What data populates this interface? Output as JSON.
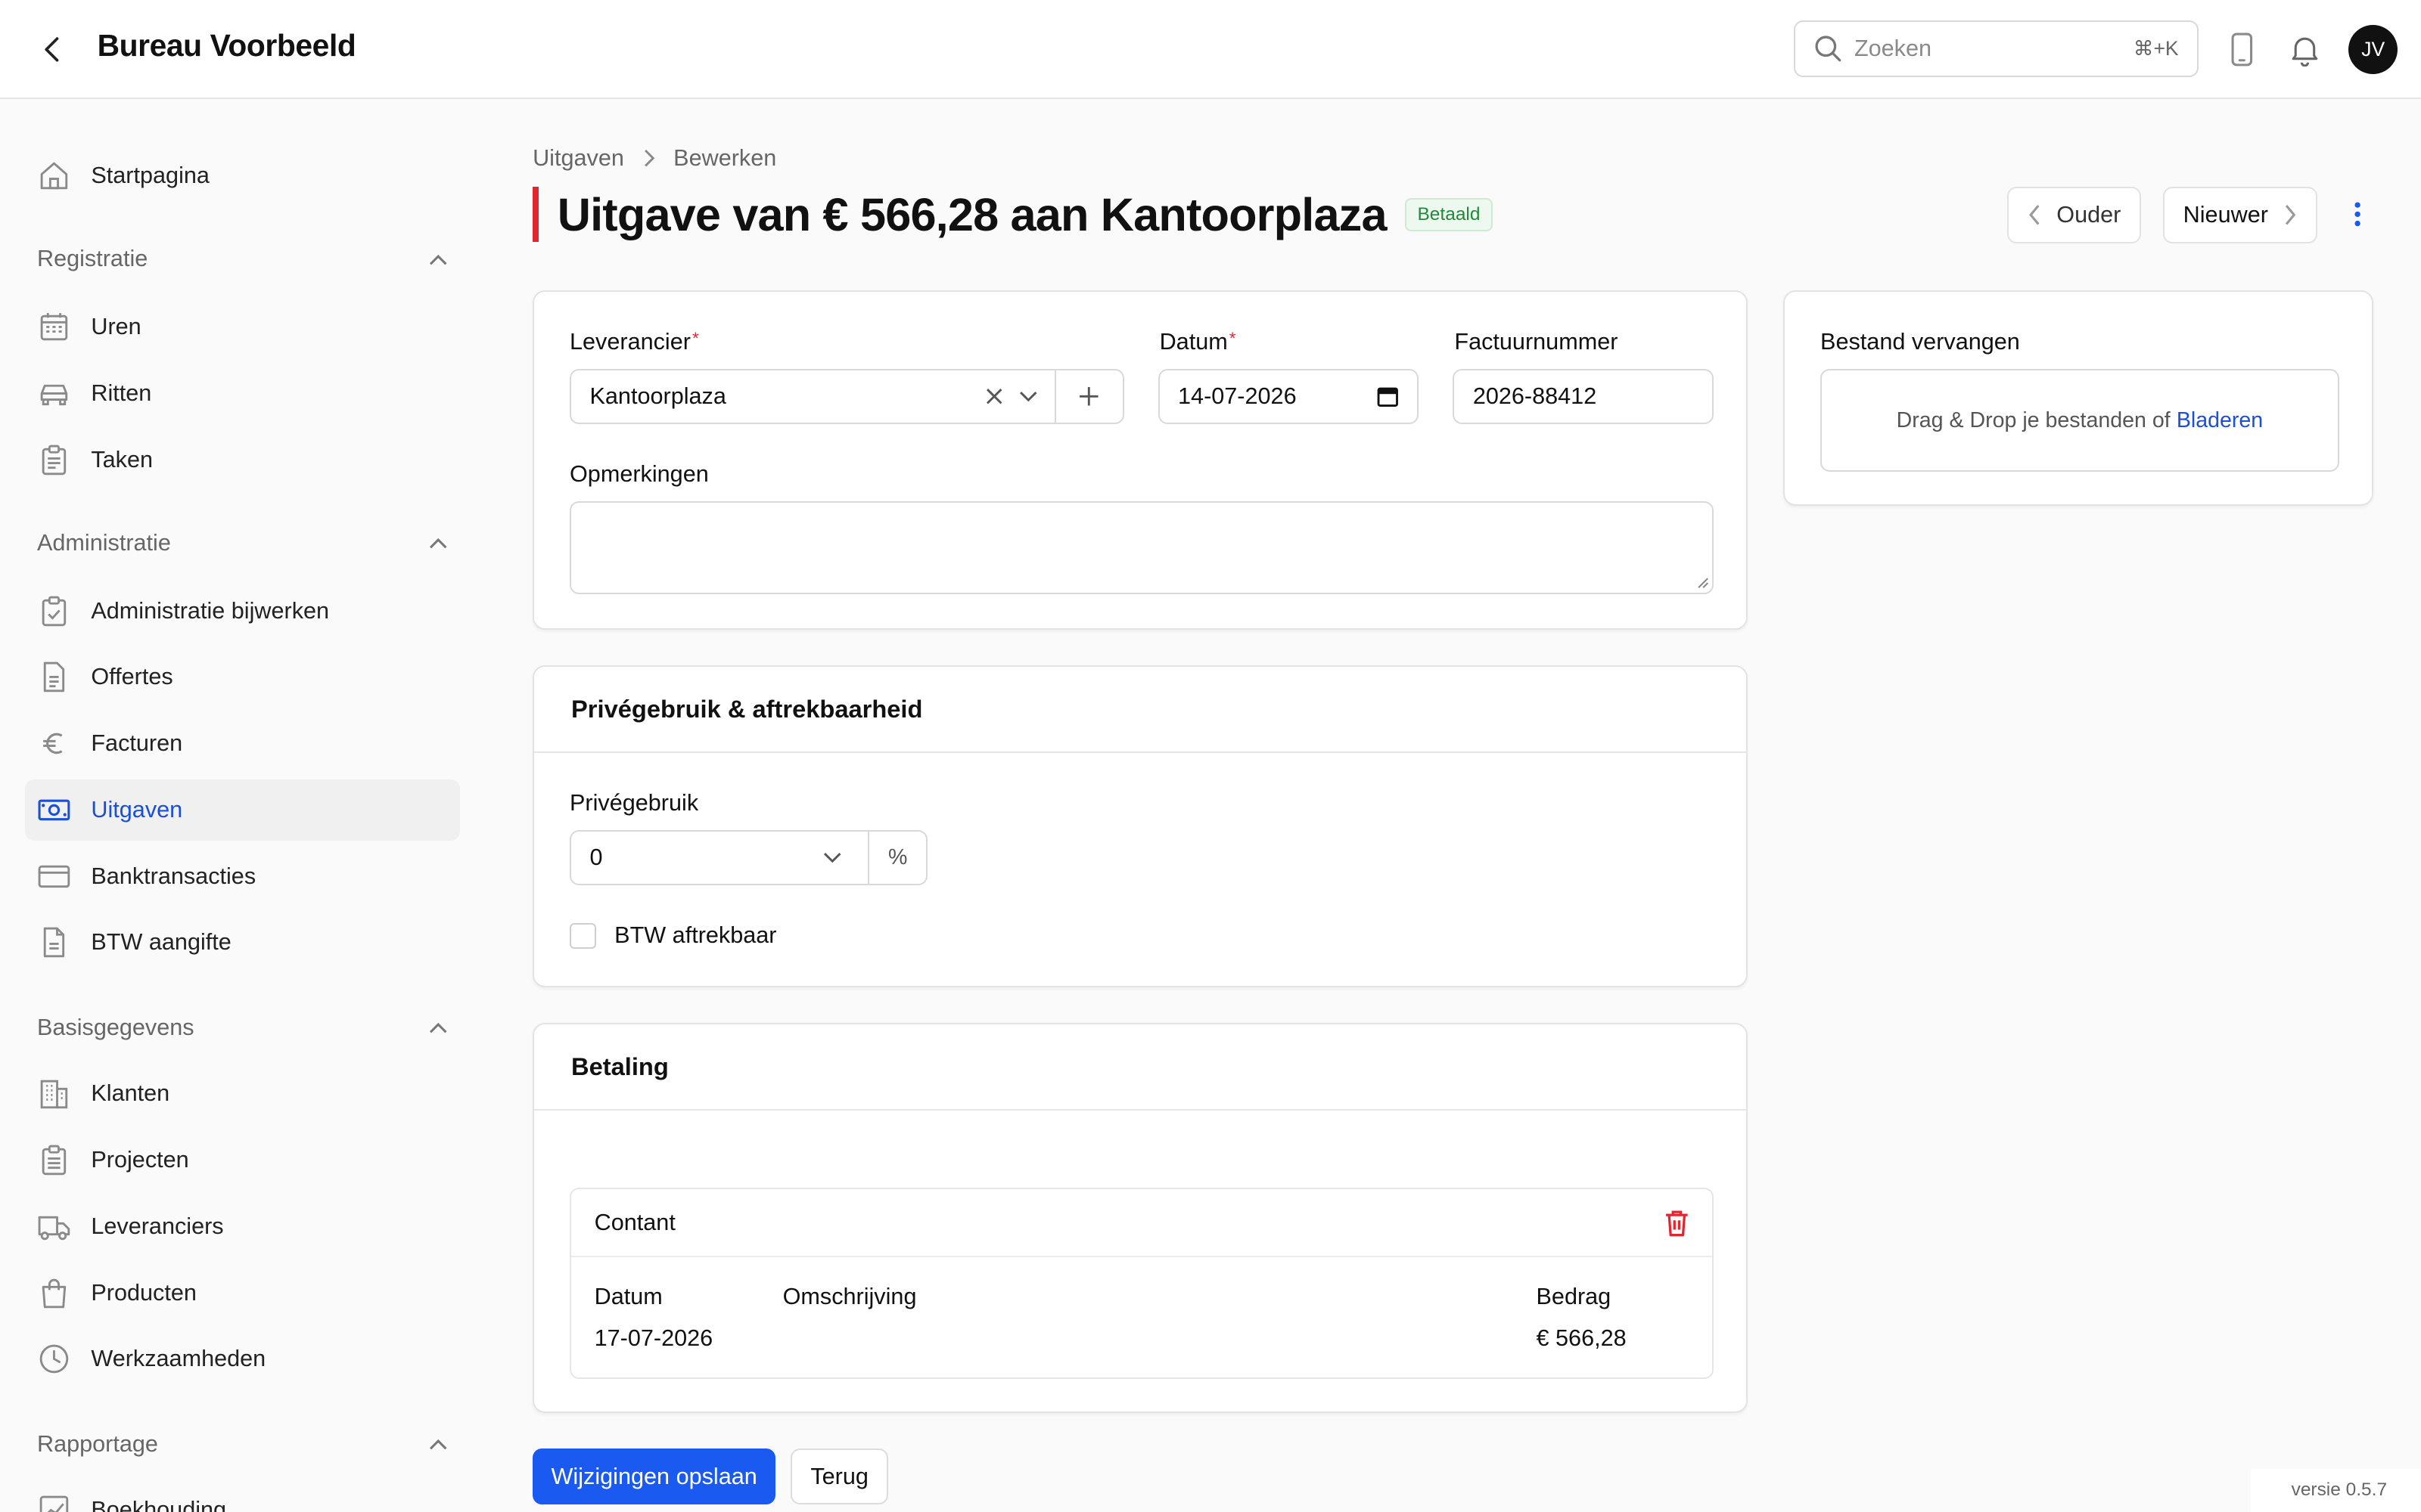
{
  "app": {
    "title": "Bureau Voorbeeld"
  },
  "topbar": {
    "search_placeholder": "Zoeken",
    "search_shortcut": "⌘+K",
    "avatar_initials": "JV"
  },
  "sidebar": {
    "home": "Startpagina",
    "sections": [
      {
        "title": "Registratie",
        "items": [
          "Uren",
          "Ritten",
          "Taken"
        ]
      },
      {
        "title": "Administratie",
        "items": [
          "Administratie bijwerken",
          "Offertes",
          "Facturen",
          "Uitgaven",
          "Banktransacties",
          "BTW aangifte"
        ]
      },
      {
        "title": "Basisgegevens",
        "items": [
          "Klanten",
          "Projecten",
          "Leveranciers",
          "Producten",
          "Werkzaamheden"
        ]
      },
      {
        "title": "Rapportage",
        "items": [
          "Boekhouding"
        ]
      }
    ],
    "active_item": "Uitgaven"
  },
  "breadcrumb": {
    "parent": "Uitgaven",
    "current": "Bewerken"
  },
  "page": {
    "title": "Uitgave van € 566,28 aan Kantoorplaza",
    "status": "Betaald",
    "prev_label": "Ouder",
    "next_label": "Nieuwer"
  },
  "form": {
    "supplier_label": "Leverancier",
    "supplier_value": "Kantoorplaza",
    "date_label": "Datum",
    "date_value": "14-07-2026",
    "invoice_label": "Factuurnummer",
    "invoice_value": "2026-88412",
    "notes_label": "Opmerkingen",
    "notes_value": ""
  },
  "file": {
    "label": "Bestand vervangen",
    "dropzone_text": "Drag & Drop je bestanden of",
    "browse_link": "Bladeren"
  },
  "private_use": {
    "header": "Privégebruik & aftrekbaarheid",
    "label": "Privégebruik",
    "value": "0",
    "unit": "%",
    "vat_label": "BTW aftrekbaar",
    "vat_checked": false
  },
  "payment": {
    "header": "Betaling",
    "method": "Contant",
    "columns": [
      "Datum",
      "Omschrijving",
      "Bedrag"
    ],
    "row": {
      "date": "17-07-2026",
      "description": "",
      "amount": "€ 566,28"
    }
  },
  "actions": {
    "save": "Wijzigingen opslaan",
    "back": "Terug"
  },
  "footer": {
    "version": "versie 0.5.7"
  },
  "colors": {
    "primary": "#1a5af0",
    "accent_red": "#e0262f",
    "success": "#1f8a3a",
    "active_nav": "#1a4fd6"
  }
}
